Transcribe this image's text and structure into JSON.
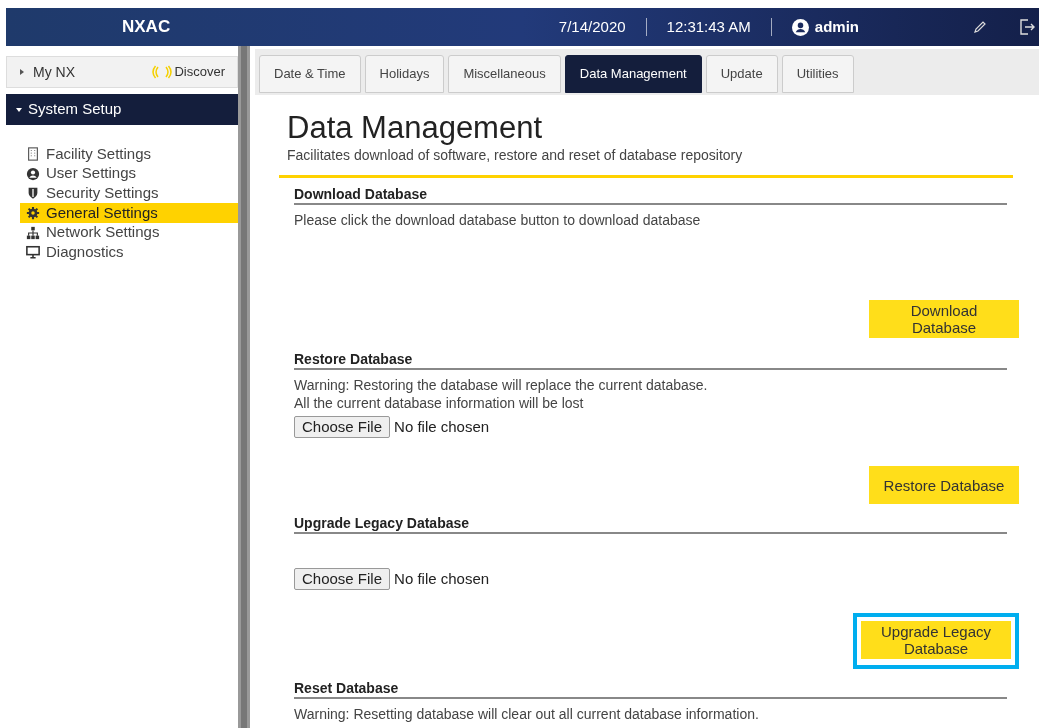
{
  "header": {
    "app_name": "NXAC",
    "date": "7/14/2020",
    "time": "12:31:43 AM",
    "user": "admin"
  },
  "sidebar": {
    "top_item": {
      "label": "My NX",
      "expanded": false
    },
    "discover": "Discover",
    "section": {
      "label": "System Setup",
      "expanded": true
    },
    "items": [
      {
        "label": "Facility Settings",
        "selected": false
      },
      {
        "label": "User Settings",
        "selected": false
      },
      {
        "label": "Security Settings",
        "selected": false
      },
      {
        "label": "General Settings",
        "selected": true
      },
      {
        "label": "Network Settings",
        "selected": false
      },
      {
        "label": "Diagnostics",
        "selected": false
      }
    ]
  },
  "tabs": [
    {
      "label": "Date & Time",
      "selected": false
    },
    {
      "label": "Holidays",
      "selected": false
    },
    {
      "label": "Miscellaneous",
      "selected": false
    },
    {
      "label": "Data Management",
      "selected": true
    },
    {
      "label": "Update",
      "selected": false
    },
    {
      "label": "Utilities",
      "selected": false
    }
  ],
  "page": {
    "title": "Data Management",
    "subtitle": "Facilitates download of software, restore and reset of database repository"
  },
  "sections": [
    {
      "title": "Download Database",
      "description": [
        "Please click the download database button to download database"
      ],
      "action": {
        "label": "Download Database",
        "highlighted": false
      }
    },
    {
      "title": "Restore Database",
      "description": [
        "Warning: Restoring the database will replace the current database.",
        "All the current database information will be lost"
      ],
      "file_input": {
        "button": "Choose File",
        "status": "No file chosen"
      },
      "action": {
        "label": "Restore Database",
        "highlighted": false
      }
    },
    {
      "title": "Upgrade Legacy Database",
      "file_input": {
        "button": "Choose File",
        "status": "No file chosen"
      },
      "action": {
        "label": "Upgrade Legacy Database",
        "highlighted": true
      }
    },
    {
      "title": "Reset Database",
      "description": [
        "Warning: Resetting database will clear out all current database information."
      ]
    }
  ]
}
